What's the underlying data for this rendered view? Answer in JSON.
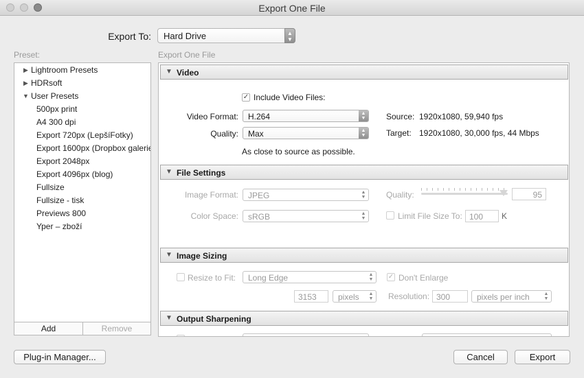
{
  "window": {
    "title": "Export One File"
  },
  "export_to": {
    "label": "Export To:",
    "value": "Hard Drive"
  },
  "preset": {
    "label": "Preset:",
    "items": [
      {
        "label": "Lightroom Presets",
        "type": "folder",
        "expanded": false
      },
      {
        "label": "HDRsoft",
        "type": "folder",
        "expanded": false
      },
      {
        "label": "User Presets",
        "type": "folder",
        "expanded": true
      },
      {
        "label": "500px print",
        "type": "preset"
      },
      {
        "label": "A4 300 dpi",
        "type": "preset"
      },
      {
        "label": "Export 720px (LepšíFotky)",
        "type": "preset"
      },
      {
        "label": "Export 1600px (Dropbox galerie",
        "type": "preset"
      },
      {
        "label": "Export 2048px",
        "type": "preset"
      },
      {
        "label": "Export 4096px (blog)",
        "type": "preset"
      },
      {
        "label": "Fullsize",
        "type": "preset"
      },
      {
        "label": "Fullsize - tisk",
        "type": "preset"
      },
      {
        "label": "Previews 800",
        "type": "preset"
      },
      {
        "label": "Yper – zboží",
        "type": "preset"
      }
    ],
    "add_label": "Add",
    "remove_label": "Remove"
  },
  "panel_label": "Export One File",
  "video": {
    "title": "Video",
    "include_label": "Include Video Files:",
    "include_checked": true,
    "format_label": "Video Format:",
    "format_value": "H.264",
    "quality_label": "Quality:",
    "quality_value": "Max",
    "hint": "As close to source as possible.",
    "source_label": "Source:",
    "source_value": "1920x1080, 59,940 fps",
    "target_label": "Target:",
    "target_value": "1920x1080, 30,000 fps, 44 Mbps"
  },
  "file_settings": {
    "title": "File Settings",
    "image_format_label": "Image Format:",
    "image_format_value": "JPEG",
    "quality_label": "Quality:",
    "quality_value": "95",
    "quality_level": 0.95,
    "color_space_label": "Color Space:",
    "color_space_value": "sRGB",
    "limit_label": "Limit File Size To:",
    "limit_value": "100",
    "limit_unit": "K"
  },
  "image_sizing": {
    "title": "Image Sizing",
    "resize_label": "Resize to Fit:",
    "resize_value": "Long Edge",
    "dont_enlarge_label": "Don't Enlarge",
    "dont_enlarge_checked": true,
    "size_value": "3153",
    "size_unit": "pixels",
    "resolution_label": "Resolution:",
    "resolution_value": "300",
    "resolution_unit": "pixels per inch"
  },
  "output_sharpening": {
    "title": "Output Sharpening"
  },
  "buttons": {
    "plugin_manager": "Plug-in Manager...",
    "cancel": "Cancel",
    "export": "Export"
  }
}
